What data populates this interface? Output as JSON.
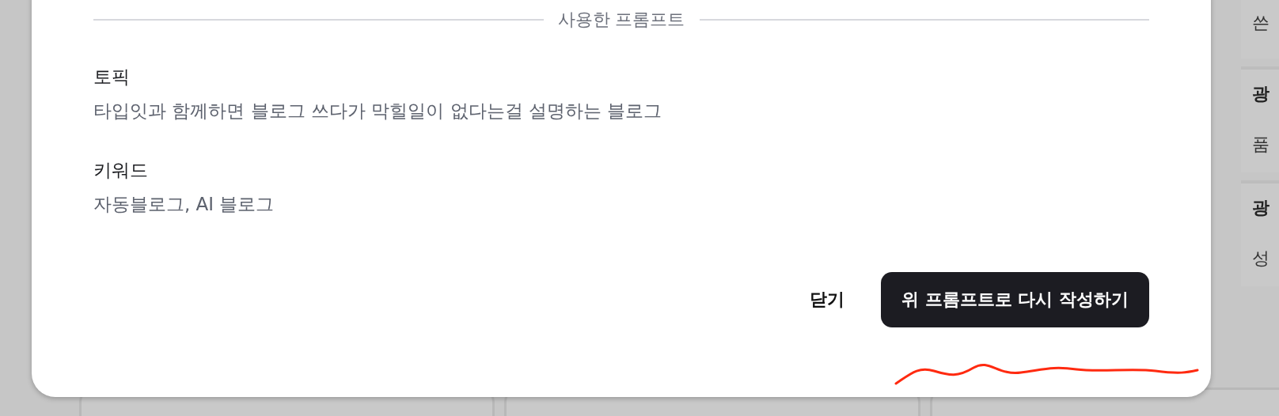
{
  "background_cards": [
    {
      "texts": [
        "쓴"
      ]
    },
    {
      "texts": [
        "광",
        "품"
      ]
    },
    {
      "texts": [
        "광",
        "성"
      ]
    }
  ],
  "dialog": {
    "section_title": "사용한 프롬프트",
    "fields": [
      {
        "label": "토픽",
        "value": "타입잇과 함께하면 블로그 쓰다가 막힐일이 없다는걸 설명하는 블로그"
      },
      {
        "label": "키워드",
        "value": "자동블로그, AI 블로그"
      }
    ],
    "buttons": [
      {
        "label": "닫기",
        "kind": "text"
      },
      {
        "label": "위 프롬프트로 다시 작성하기",
        "kind": "primary"
      }
    ]
  }
}
